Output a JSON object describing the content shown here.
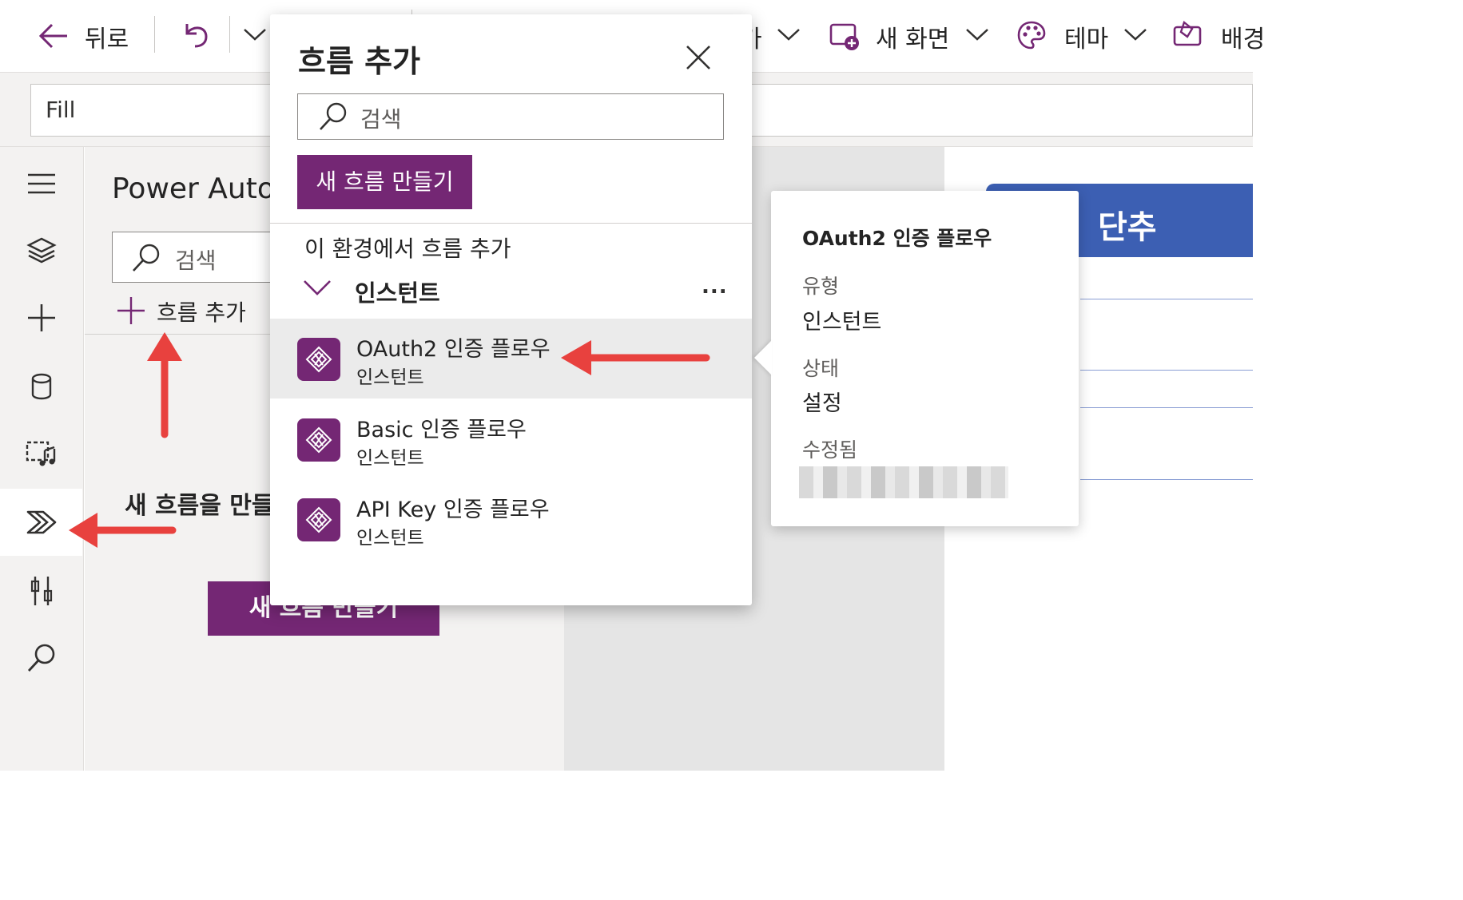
{
  "toolbar": {
    "back_label": "뒤로",
    "truncated_label": "가",
    "new_screen_label": "새 화면",
    "theme_label": "테마",
    "background_label": "배경"
  },
  "formula_bar": {
    "property": "Fill"
  },
  "panel": {
    "title": "Power Automate",
    "search_placeholder": "검색",
    "add_flow_label": "흐름 추가",
    "empty_message": "새 흐름을 만들",
    "create_button_label": "새 흐름 만들기"
  },
  "flyout": {
    "title": "흐름 추가",
    "search_placeholder": "검색",
    "create_button_label": "새 흐름 만들기",
    "section_label": "이 환경에서 흐름 추가",
    "group_label": "인스턴트",
    "more_label": "...",
    "flows": [
      {
        "name": "OAuth2 인증 플로우",
        "type": "인스턴트"
      },
      {
        "name": "Basic 인증 플로우",
        "type": "인스턴트"
      },
      {
        "name": "API Key 인증 플로우",
        "type": "인스턴트"
      }
    ]
  },
  "details_card": {
    "title": "OAuth2 인증 플로우",
    "type_label": "유형",
    "type_value": "인스턴트",
    "status_label": "상태",
    "status_value": "설정",
    "modified_label": "수정됨"
  },
  "canvas": {
    "header_text": "단추"
  },
  "colors": {
    "accent": "#742774",
    "canvas_header": "#3c5fb3",
    "annotation_arrow": "#e8413e"
  },
  "icons": [
    "back-arrow-icon",
    "undo-icon",
    "chevron-down-icon",
    "new-screen-icon",
    "theme-palette-icon",
    "background-icon",
    "hamburger-icon",
    "layers-icon",
    "plus-icon",
    "database-icon",
    "media-icon",
    "power-automate-icon",
    "tools-icon",
    "search-icon",
    "close-icon",
    "flow-icon"
  ]
}
